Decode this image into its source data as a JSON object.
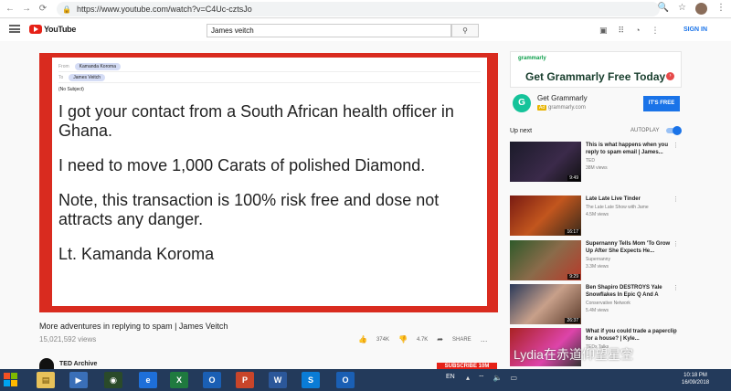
{
  "browser": {
    "url": "https://www.youtube.com/watch?v=C4Uc-cztsJo"
  },
  "youtube": {
    "logo_text": "YouTube",
    "search_value": "James veitch",
    "signin_label": "SIGN IN"
  },
  "email": {
    "from_label": "From",
    "from_name": "Kamanda Koroma",
    "to_label": "To",
    "to_name": "James Veitch",
    "subject": "(No Subject)",
    "paragraphs": [
      "I got your contact from a South African health officer in Ghana.",
      "I need to move 1,000 Carats of polished Diamond.",
      "Note, this transaction is 100% risk free and dose not attracts any danger.",
      "Lt. Kamanda Koroma"
    ]
  },
  "video": {
    "title": "More adventures in replying to spam | James Veitch",
    "views": "15,021,592 views",
    "likes": "374K",
    "dislikes": "4.7K",
    "share_label": "SHARE",
    "channel_name": "TED Archive",
    "subscribe_label": "SUBSCRIBE 10M"
  },
  "ad": {
    "banner_brand": "grammarly",
    "banner_text": "Get Grammarly Free Today",
    "card_title": "Get Grammarly",
    "card_badge": "Ad",
    "card_url": "grammarly.com",
    "cta_label": "IT'S FREE",
    "brand_color": "#15c39a"
  },
  "sidebar": {
    "upnext_label": "Up next",
    "autoplay_label": "AUTOPLAY",
    "items": [
      {
        "title": "This is what happens when you reply to spam email | James...",
        "channel": "TED",
        "views": "38M views",
        "duration": "9:49"
      },
      {
        "title": "Late Late Live Tinder",
        "channel": "The Late Late Show with Jame",
        "views": "4.5M views",
        "duration": "16:17"
      },
      {
        "title": "Supernanny Tells Mom 'To Grow Up After She Expects He...",
        "channel": "Supernanny",
        "views": "3.3M views",
        "duration": "9:29"
      },
      {
        "title": "Ben Shapiro DESTROYS Yale Snowflakes In Epic Q And A",
        "channel": "Conservative Network",
        "views": "5.4M views",
        "duration": "26:37"
      },
      {
        "title": "What if you could trade a paperclip for a house? | Kyle...",
        "channel": "TEDx Talks",
        "views": "",
        "duration": ""
      }
    ]
  },
  "taskbar": {
    "lang": "EN",
    "time": "10:18 PM",
    "date": "16/09/2018"
  },
  "watermark": "Lydia在赤道仰望星空"
}
